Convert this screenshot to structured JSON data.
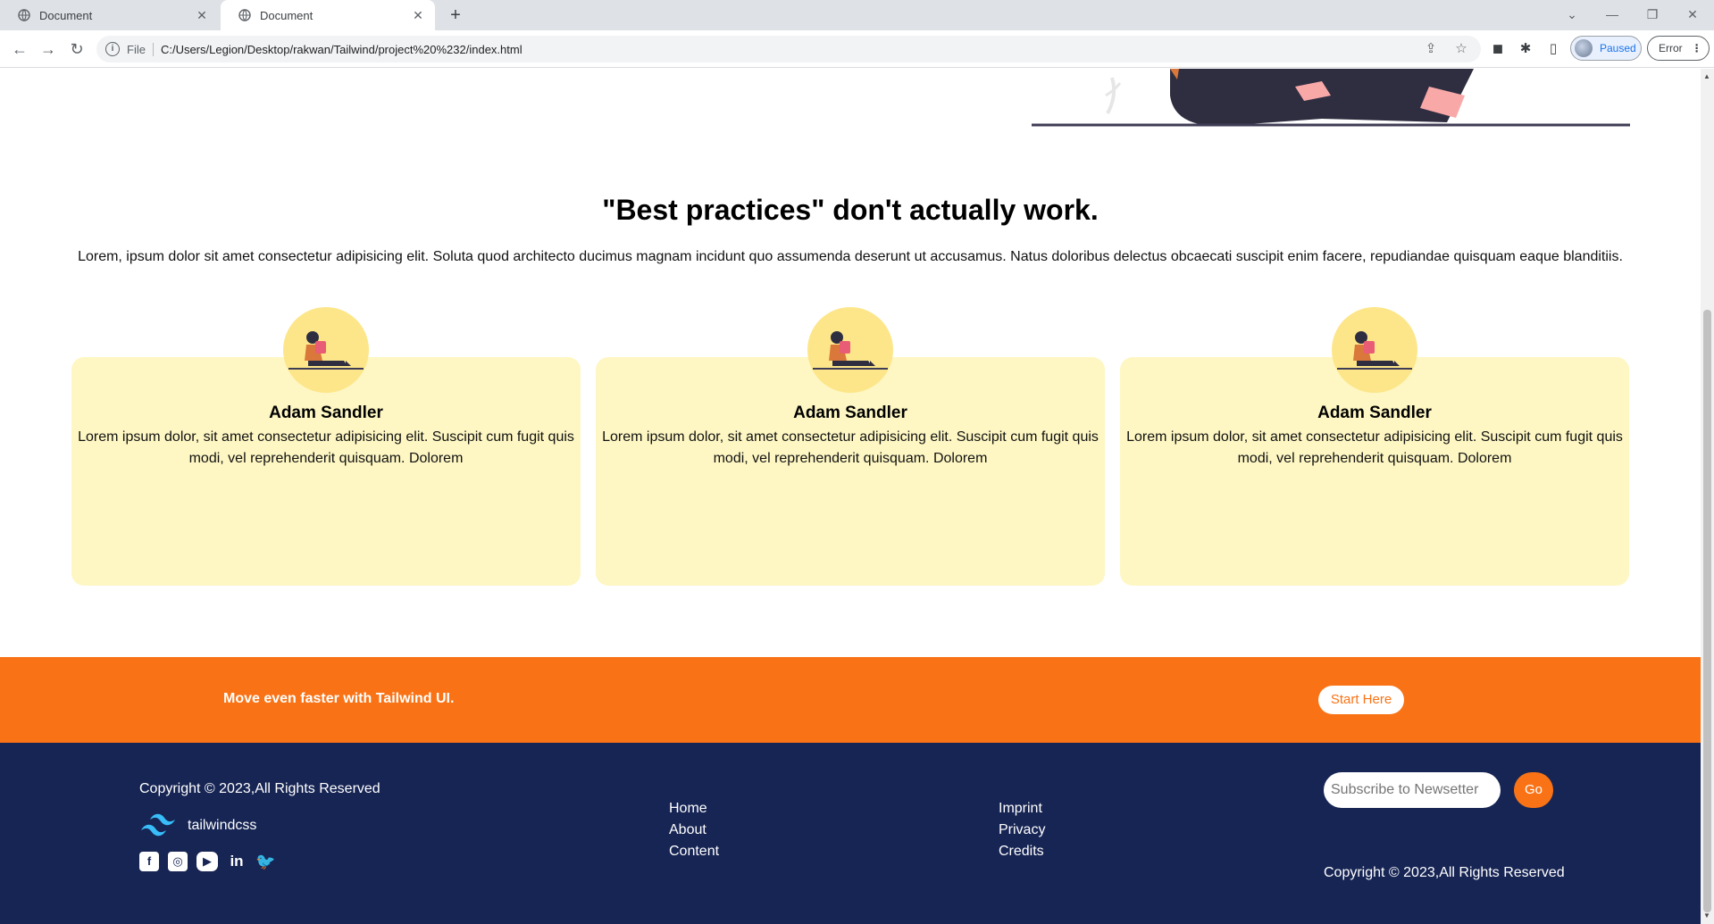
{
  "browser": {
    "tabs": [
      {
        "title": "Document",
        "active": false
      },
      {
        "title": "Document",
        "active": true
      }
    ],
    "url_scheme": "File",
    "url": "C:/Users/Legion/Desktop/rakwan/Tailwind/project%20%232/index.html",
    "profile_status": "Paused",
    "error_label": "Error"
  },
  "section": {
    "heading": "\"Best practices\" don't actually work.",
    "intro": "Lorem, ipsum dolor sit amet consectetur adipisicing elit. Soluta quod architecto ducimus magnam incidunt quo assumenda deserunt ut accusamus. Natus doloribus delectus obcaecati suscipit enim facere, repudiandae quisquam eaque blanditiis."
  },
  "cards": [
    {
      "name": "Adam Sandler",
      "text": "Lorem ipsum dolor, sit amet consectetur adipisicing elit. Suscipit cum fugit quis modi, vel reprehenderit quisquam. Dolorem"
    },
    {
      "name": "Adam Sandler",
      "text": "Lorem ipsum dolor, sit amet consectetur adipisicing elit. Suscipit cum fugit quis modi, vel reprehenderit quisquam. Dolorem"
    },
    {
      "name": "Adam Sandler",
      "text": "Lorem ipsum dolor, sit amet consectetur adipisicing elit. Suscipit cum fugit quis modi, vel reprehenderit quisquam. Dolorem"
    }
  ],
  "cta": {
    "text": "Move even faster with Tailwind UI.",
    "button": "Start Here"
  },
  "footer": {
    "copyright_left": "Copyright © 2023,All Rights Reserved",
    "logo_text": "tailwindcss",
    "socials": [
      "facebook-icon",
      "instagram-icon",
      "youtube-icon",
      "linkedin-icon",
      "twitter-icon"
    ],
    "links_col1": [
      "Home",
      "About",
      "Content"
    ],
    "links_col2": [
      "Imprint",
      "Privacy",
      "Credits"
    ],
    "newsletter_placeholder": "Subscribe to Newsetter",
    "go_button": "Go",
    "copyright_right": "Copyright © 2023,All Rights Reserved"
  },
  "colors": {
    "accent_orange": "#f97316",
    "footer_navy": "#172554",
    "card_yellow": "#fef7c3",
    "avatar_yellow": "#fde68a"
  }
}
